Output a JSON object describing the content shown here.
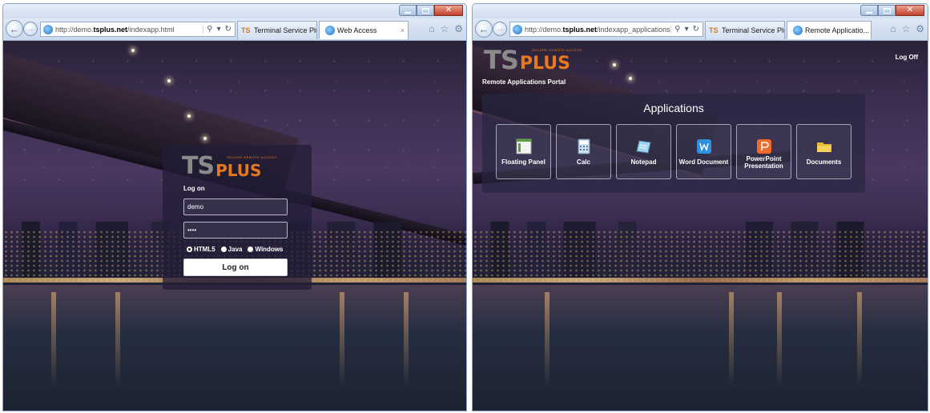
{
  "colors": {
    "brand_orange": "#e8781e",
    "brand_gray": "#8a8a8a",
    "chrome_blue": "#dce7f4",
    "close_red": "#c4402a"
  },
  "left_window": {
    "address": {
      "prefix": "http://demo.",
      "domain": "tsplus.net",
      "path": "/indexapp.html"
    },
    "tabs": [
      {
        "label": "Terminal Service Plus ...",
        "icon": "tsplus-icon"
      },
      {
        "label": "Web Access",
        "icon": "ie-icon",
        "close": "×"
      }
    ],
    "login": {
      "logo_ts": "TS",
      "logo_plus": "PLUS",
      "logo_tagline": "SECURE REMOTE ACCESS",
      "label": "Log on",
      "username_value": "demo",
      "password_value": "••••",
      "modes": [
        "HTML5",
        "Java",
        "Windows"
      ],
      "selected_mode": "HTML5",
      "button": "Log on"
    }
  },
  "right_window": {
    "address": {
      "prefix": "http://demo.",
      "domain": "tsplus.net",
      "path": "/indexapp_applications.htm"
    },
    "tabs": [
      {
        "label": "Terminal Service Plus ...",
        "icon": "tsplus-icon"
      },
      {
        "label": "Remote Applicatio...",
        "icon": "ie-icon",
        "close": "×"
      }
    ],
    "portal": {
      "logo_ts": "TS",
      "logo_plus": "PLUS",
      "logo_tagline": "SECURE REMOTE ACCESS",
      "title": "Remote Applications Portal",
      "logoff": "Log Off",
      "heading": "Applications",
      "apps": [
        {
          "label": "Floating Panel",
          "icon": "floating-panel-icon"
        },
        {
          "label": "Calc",
          "icon": "calculator-icon"
        },
        {
          "label": "Notepad",
          "icon": "notepad-icon"
        },
        {
          "label": "Word Document",
          "icon": "word-icon"
        },
        {
          "label": "PowerPoint Presentation",
          "label_lines": [
            "PowerPoint",
            "Presentation"
          ],
          "icon": "powerpoint-icon"
        },
        {
          "label": "Documents",
          "icon": "folder-icon"
        }
      ]
    }
  }
}
